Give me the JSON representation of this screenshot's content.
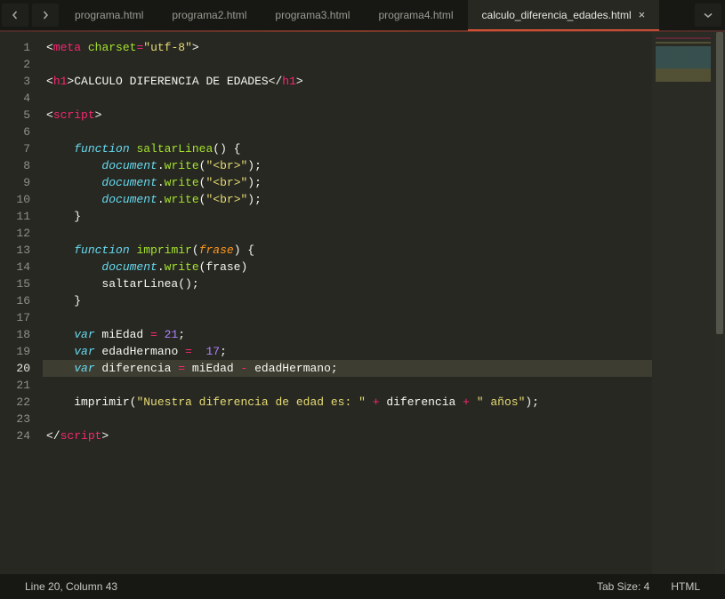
{
  "tabs": [
    {
      "label": "programa.html",
      "active": false
    },
    {
      "label": "programa2.html",
      "active": false
    },
    {
      "label": "programa3.html",
      "active": false
    },
    {
      "label": "programa4.html",
      "active": false
    },
    {
      "label": "calculo_diferencia_edades.html",
      "active": true
    }
  ],
  "gutter": {
    "lines": [
      "1",
      "2",
      "3",
      "4",
      "5",
      "6",
      "7",
      "8",
      "9",
      "10",
      "11",
      "12",
      "13",
      "14",
      "15",
      "16",
      "17",
      "18",
      "19",
      "20",
      "21",
      "22",
      "23",
      "24"
    ],
    "current": 20
  },
  "code_lines": [
    [
      [
        "an",
        "<"
      ],
      [
        "tg",
        "meta"
      ],
      [
        "p",
        " "
      ],
      [
        "at",
        "charset"
      ],
      [
        "op",
        "="
      ],
      [
        "st",
        "\"utf-8\""
      ],
      [
        "an",
        ">"
      ]
    ],
    [],
    [
      [
        "an",
        "<"
      ],
      [
        "tg",
        "h1"
      ],
      [
        "an",
        ">"
      ],
      [
        "p",
        "CALCULO DIFERENCIA DE EDADES"
      ],
      [
        "an",
        "</"
      ],
      [
        "tg",
        "h1"
      ],
      [
        "an",
        ">"
      ]
    ],
    [],
    [
      [
        "an",
        "<"
      ],
      [
        "tg",
        "script"
      ],
      [
        "an",
        ">"
      ]
    ],
    [],
    [
      [
        "p",
        "    "
      ],
      [
        "fn",
        "function"
      ],
      [
        "p",
        " "
      ],
      [
        "at",
        "saltarLinea"
      ],
      [
        "pn",
        "() {"
      ]
    ],
    [
      [
        "p",
        "        "
      ],
      [
        "vr",
        "document"
      ],
      [
        "pn",
        "."
      ],
      [
        "at",
        "write"
      ],
      [
        "pn",
        "("
      ],
      [
        "st",
        "\"<br>\""
      ],
      [
        "pn",
        ");"
      ]
    ],
    [
      [
        "p",
        "        "
      ],
      [
        "vr",
        "document"
      ],
      [
        "pn",
        "."
      ],
      [
        "at",
        "write"
      ],
      [
        "pn",
        "("
      ],
      [
        "st",
        "\"<br>\""
      ],
      [
        "pn",
        ");"
      ]
    ],
    [
      [
        "p",
        "        "
      ],
      [
        "vr",
        "document"
      ],
      [
        "pn",
        "."
      ],
      [
        "at",
        "write"
      ],
      [
        "pn",
        "("
      ],
      [
        "st",
        "\"<br>\""
      ],
      [
        "pn",
        ");"
      ]
    ],
    [
      [
        "p",
        "    }"
      ]
    ],
    [],
    [
      [
        "p",
        "    "
      ],
      [
        "fn",
        "function"
      ],
      [
        "p",
        " "
      ],
      [
        "at",
        "imprimir"
      ],
      [
        "pn",
        "("
      ],
      [
        "pr",
        "frase"
      ],
      [
        "pn",
        ") {"
      ]
    ],
    [
      [
        "p",
        "        "
      ],
      [
        "vr",
        "document"
      ],
      [
        "pn",
        "."
      ],
      [
        "at",
        "write"
      ],
      [
        "pn",
        "(frase)"
      ]
    ],
    [
      [
        "p",
        "        "
      ],
      [
        "p",
        "saltarLinea"
      ],
      [
        "pn",
        "();"
      ]
    ],
    [
      [
        "p",
        "    }"
      ]
    ],
    [],
    [
      [
        "p",
        "    "
      ],
      [
        "fn",
        "var"
      ],
      [
        "p",
        " miEdad "
      ],
      [
        "op",
        "="
      ],
      [
        "p",
        " "
      ],
      [
        "nm",
        "21"
      ],
      [
        "pn",
        ";"
      ]
    ],
    [
      [
        "p",
        "    "
      ],
      [
        "fn",
        "var"
      ],
      [
        "p",
        " edadHermano "
      ],
      [
        "op",
        "="
      ],
      [
        "p",
        "  "
      ],
      [
        "nm",
        "17"
      ],
      [
        "pn",
        ";"
      ]
    ],
    [
      [
        "p",
        "    "
      ],
      [
        "fn",
        "var"
      ],
      [
        "p",
        " diferencia "
      ],
      [
        "op",
        "="
      ],
      [
        "p",
        " miEdad "
      ],
      [
        "op",
        "-"
      ],
      [
        "p",
        " edadHermano"
      ],
      [
        "pn",
        ";"
      ]
    ],
    [],
    [
      [
        "p",
        "    imprimir"
      ],
      [
        "pn",
        "("
      ],
      [
        "st",
        "\"Nuestra diferencia de edad es: \""
      ],
      [
        "p",
        " "
      ],
      [
        "op",
        "+"
      ],
      [
        "p",
        " diferencia "
      ],
      [
        "op",
        "+"
      ],
      [
        "p",
        " "
      ],
      [
        "st",
        "\" años\""
      ],
      [
        "pn",
        ");"
      ]
    ],
    [],
    [
      [
        "an",
        "</"
      ],
      [
        "tg",
        "script"
      ],
      [
        "an",
        ">"
      ]
    ]
  ],
  "status": {
    "cursor": "Line 20, Column 43",
    "tabsize": "Tab Size: 4",
    "syntax": "HTML"
  }
}
